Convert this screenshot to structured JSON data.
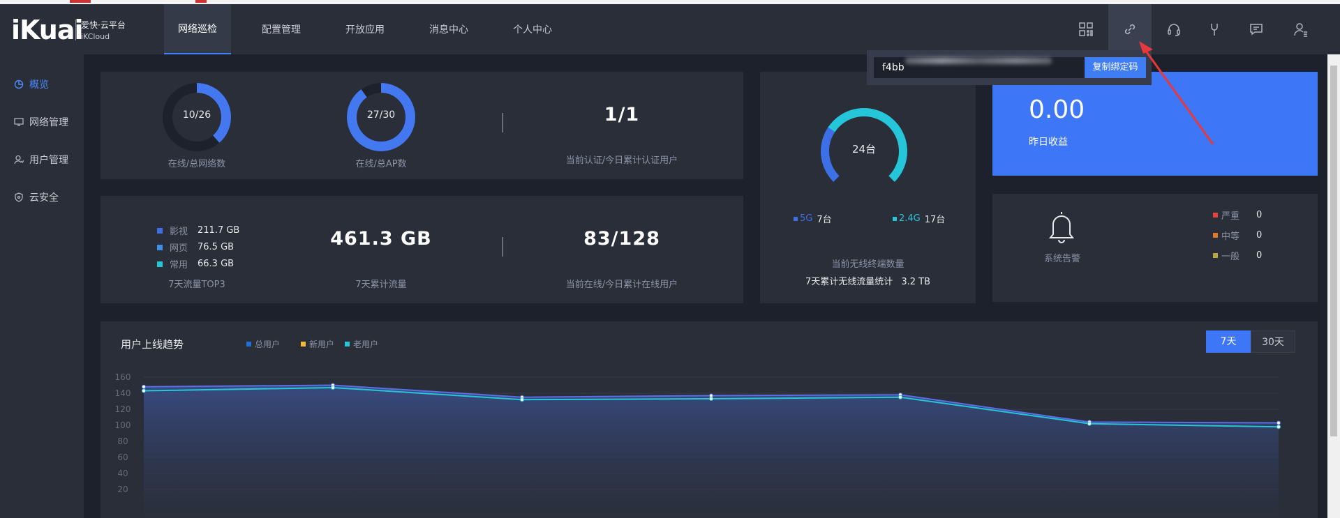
{
  "brand": {
    "logo_text": "iKuai",
    "name_cn": "爱快·云平台",
    "name_en": "iKCloud"
  },
  "nav": {
    "tabs": [
      {
        "label": "网络巡检",
        "active": true
      },
      {
        "label": "配置管理"
      },
      {
        "label": "开放应用"
      },
      {
        "label": "消息中心"
      },
      {
        "label": "个人中心"
      }
    ],
    "icons": [
      "grid-icon",
      "link-icon",
      "headset-icon",
      "wrench-icon",
      "message-icon",
      "user-settings-icon"
    ]
  },
  "popup": {
    "code_prefix": "f4bb",
    "copy_label": "复制绑定码"
  },
  "sidebar": {
    "items": [
      {
        "label": "概览",
        "icon": "pie-chart-icon",
        "active": true
      },
      {
        "label": "网络管理",
        "icon": "monitor-icon"
      },
      {
        "label": "用户管理",
        "icon": "user-icon"
      },
      {
        "label": "云安全",
        "icon": "shield-icon"
      }
    ]
  },
  "stats": {
    "networks": {
      "value": "10/26",
      "label": "在线/总网络数",
      "online": 10,
      "total": 26
    },
    "aps": {
      "value": "27/30",
      "label": "在线/总AP数",
      "online": 27,
      "total": 30
    },
    "auth": {
      "value": "1/1",
      "label": "当前认证/今日累计认证用户"
    },
    "top3": {
      "label": "7天流量TOP3",
      "items": [
        {
          "name": "影视",
          "value": "211.7 GB",
          "color": "#3d6fe6"
        },
        {
          "name": "网页",
          "value": "76.5 GB",
          "color": "#3b8fe6"
        },
        {
          "name": "常用",
          "value": "66.3 GB",
          "color": "#26c6da"
        }
      ]
    },
    "traffic": {
      "value": "461.3 GB",
      "label": "7天累计流量"
    },
    "online_users": {
      "value": "83/128",
      "label": "当前在线/今日累计在线用户"
    }
  },
  "wireless": {
    "center": "24台",
    "g5": {
      "name": "5G",
      "value": "7台",
      "count": 7,
      "color": "#3d6fe6"
    },
    "g24": {
      "name": "2.4G",
      "value": "17台",
      "count": 17,
      "color": "#26c6da"
    },
    "title": "当前无线终端数量",
    "stat_label": "7天累计无线流量统计",
    "stat_value": "3.2 TB"
  },
  "revenue": {
    "value": "0.00",
    "label": "昨日收益"
  },
  "alarm": {
    "label": "系统告警",
    "levels": [
      {
        "name": "严重",
        "value": "0",
        "color": "#e0443a"
      },
      {
        "name": "中等",
        "value": "0",
        "color": "#e07a2a"
      },
      {
        "name": "一般",
        "value": "0",
        "color": "#b8a83a"
      }
    ]
  },
  "trend": {
    "title": "用户上线趋势",
    "legend": [
      {
        "name": "总用户",
        "color": "#1e6fd9"
      },
      {
        "name": "新用户",
        "color": "#f5b93a"
      },
      {
        "name": "老用户",
        "color": "#26c6da"
      }
    ],
    "range_buttons": [
      {
        "label": "7天",
        "active": true
      },
      {
        "label": "30天"
      }
    ]
  },
  "chart_data": {
    "type": "area",
    "y_ticks": [
      "160",
      "140",
      "120",
      "100",
      "80",
      "60",
      "40",
      "20"
    ],
    "ylim": [
      20,
      160
    ],
    "x": [
      0,
      1,
      2,
      3,
      4,
      5,
      6
    ],
    "series": [
      {
        "name": "总用户",
        "values": [
          148,
          150,
          135,
          137,
          138,
          104,
          103
        ],
        "color": "#5a6ee6"
      },
      {
        "name": "老用户",
        "values": [
          143,
          147,
          132,
          133,
          135,
          102,
          98
        ],
        "color": "#26c6da"
      }
    ]
  }
}
